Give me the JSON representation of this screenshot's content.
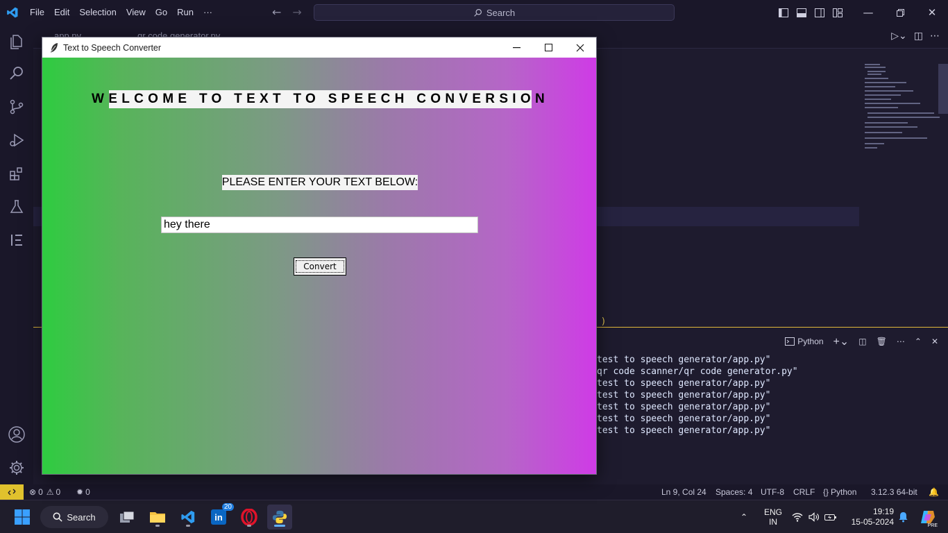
{
  "vscode": {
    "menu": [
      "File",
      "Edit",
      "Selection",
      "View",
      "Go",
      "Run",
      "···"
    ],
    "search_placeholder": "Search",
    "tabs": [
      "app.py",
      "qr code generator.py"
    ],
    "terminal": {
      "profile_label": "Python",
      "lines": [
        "test to speech generator/app.py\"",
        "qr code scanner/qr code generator.py\"",
        "test to speech generator/app.py\"",
        "test to speech generator/app.py\"",
        "test to speech generator/app.py\"",
        "test to speech generator/app.py\"",
        "test to speech generator/app.py\""
      ]
    },
    "code_fragment": ", )",
    "status_bar": {
      "errors": "0",
      "warnings": "0",
      "ports": "0",
      "cursor_position": "Ln 9, Col 24",
      "indentation": "Spaces: 4",
      "encoding": "UTF-8",
      "line_ending": "CRLF",
      "language": "Python",
      "interpreter": "3.12.3 64-bit"
    }
  },
  "tk_app": {
    "window_title": "Text to Speech Converter",
    "welcome_text": "WELCOME TO TEXT TO SPEECH CONVERSION",
    "prompt_text": "PLEASE ENTER YOUR TEXT BELOW:",
    "input_value": "hey there",
    "convert_label": "Convert",
    "gradient_start": "#2ecc40",
    "gradient_end": "#cf3be6"
  },
  "taskbar": {
    "search_label": "Search",
    "linkedin_badge": "20",
    "language_top": "ENG",
    "language_bottom": "IN",
    "time": "19:19",
    "date": "15-05-2024",
    "copilot_badge": "PRE"
  },
  "colors": {
    "vscode_bg": "#1e1b2e",
    "status_remote": "#e0c12d",
    "panel_border": "#e2b93b"
  }
}
